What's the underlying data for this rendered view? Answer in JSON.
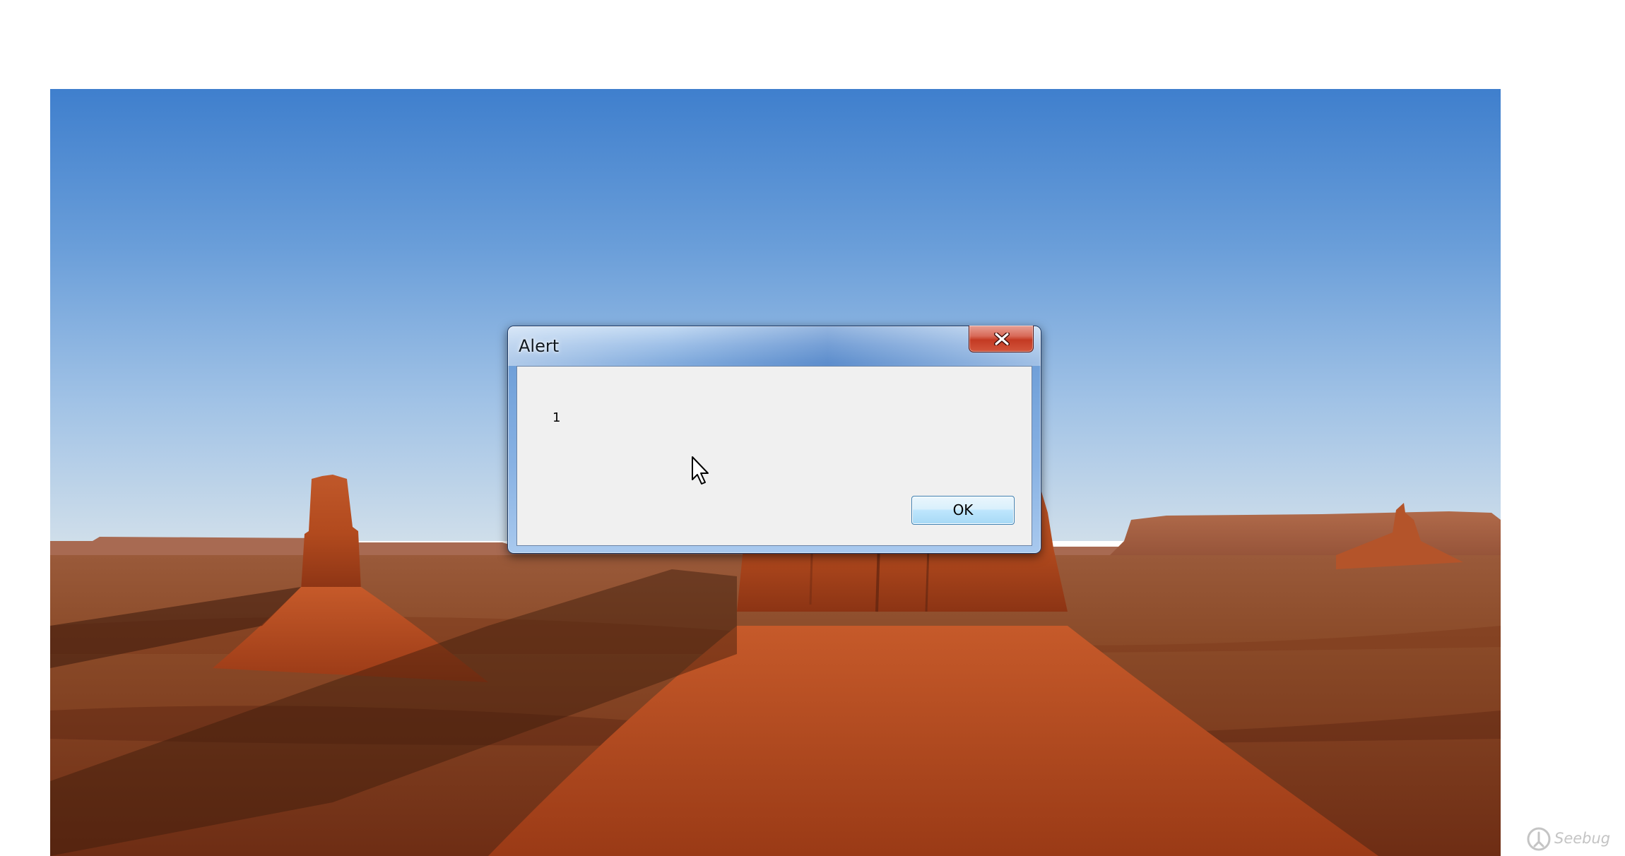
{
  "dialog": {
    "title": "Alert",
    "message": "1",
    "ok_label": "OK",
    "close_icon": "close-icon"
  },
  "cursor": {
    "icon": "arrow-cursor-icon"
  },
  "watermark": {
    "text": "Seebug",
    "icon": "seebug-logo-icon"
  },
  "colors": {
    "sky_top": "#4a86d0",
    "sky_bottom": "#bcd5ea",
    "rock": "#a94a22",
    "dialog_frame": "#6f9fd8",
    "close_button": "#c43a23",
    "dialog_client": "#f0f0f0",
    "page_background": "#ffffff"
  }
}
